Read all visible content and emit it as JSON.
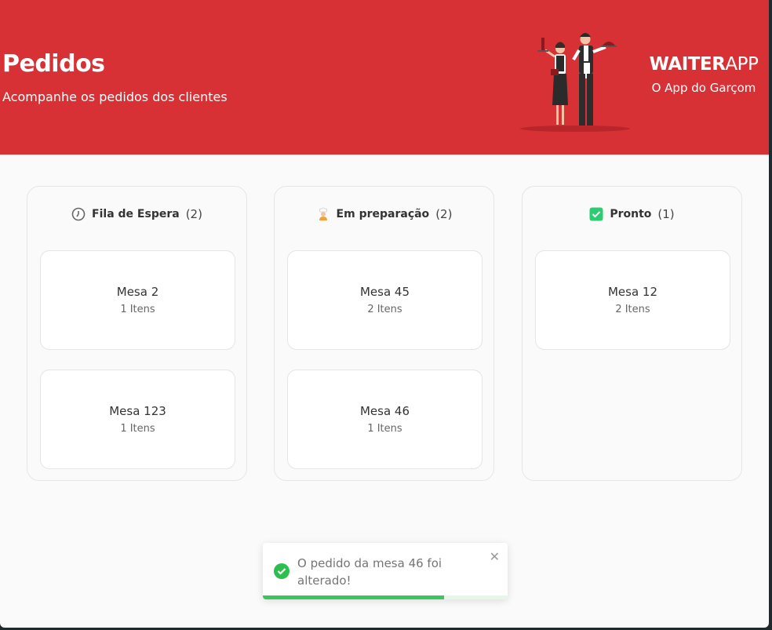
{
  "header": {
    "title": "Pedidos",
    "subtitle": "Acompanhe os pedidos dos clientes",
    "brand_bold": "WAITER",
    "brand_light": "APP",
    "tagline": "O App do Garçom"
  },
  "columns": [
    {
      "icon": "clock-icon",
      "label": "Fila de Espera",
      "count": "(2)",
      "orders": [
        {
          "table": "Mesa 2",
          "items": "1 Itens"
        },
        {
          "table": "Mesa 123",
          "items": "1 Itens"
        }
      ]
    },
    {
      "icon": "chef-icon",
      "label": "Em preparação",
      "count": "(2)",
      "orders": [
        {
          "table": "Mesa 45",
          "items": "2 Itens"
        },
        {
          "table": "Mesa 46",
          "items": "1 Itens"
        }
      ]
    },
    {
      "icon": "check-square-icon",
      "label": "Pronto",
      "count": "(1)",
      "orders": [
        {
          "table": "Mesa 12",
          "items": "2 Itens"
        }
      ]
    }
  ],
  "toast": {
    "message": "O pedido da mesa 46 foi alterado!",
    "close": "✕",
    "progress": 0.74
  },
  "colors": {
    "brand_red": "#d73035",
    "success_green": "#3bc55c"
  }
}
